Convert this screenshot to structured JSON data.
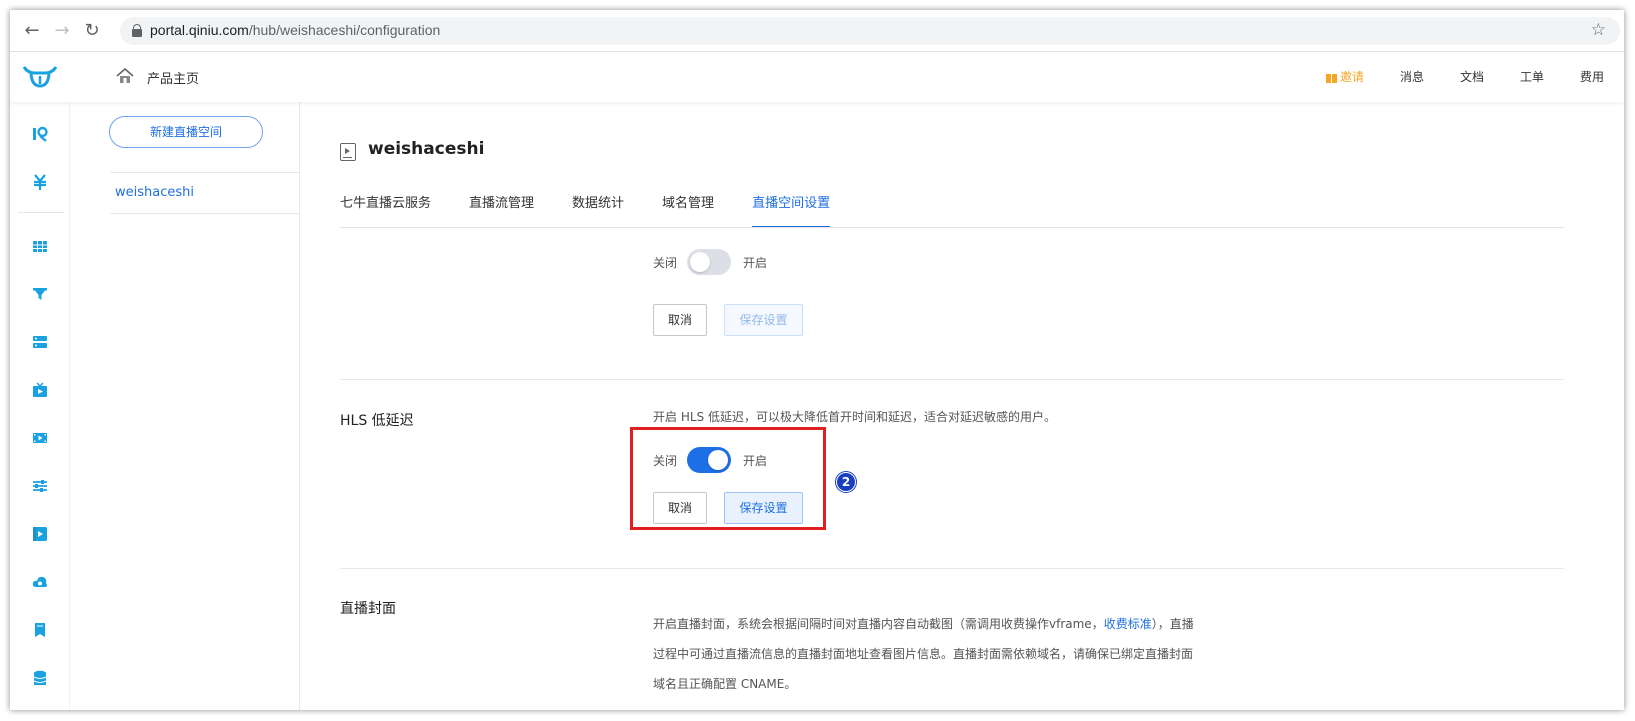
{
  "browser": {
    "url_host": "portal.qiniu.com",
    "url_path": "/hub/weishaceshi/configuration"
  },
  "header": {
    "home_label": "产品主页",
    "nav": [
      {
        "label": "邀请"
      },
      {
        "label": "消息"
      },
      {
        "label": "文档"
      },
      {
        "label": "工单"
      },
      {
        "label": "费用"
      }
    ]
  },
  "sidebar": {
    "new_space_label": "新建直播空间",
    "items": [
      {
        "label": "weishaceshi"
      }
    ]
  },
  "main": {
    "space_title": "weishaceshi",
    "tabs": [
      {
        "label": "七牛直播云服务"
      },
      {
        "label": "直播流管理"
      },
      {
        "label": "数据统计"
      },
      {
        "label": "域名管理"
      },
      {
        "label": "直播空间设置"
      }
    ],
    "sections": {
      "top": {
        "switch_off_label": "关闭",
        "switch_on_label": "开启",
        "cancel_label": "取消",
        "save_label": "保存设置",
        "enabled": false
      },
      "hls": {
        "title": "HLS 低延迟",
        "desc": "开启 HLS 低延迟，可以极大降低首开时间和延迟，适合对延迟敏感的用户。",
        "switch_off_label": "关闭",
        "switch_on_label": "开启",
        "cancel_label": "取消",
        "save_label": "保存设置",
        "enabled": true
      },
      "cover": {
        "title": "直播封面",
        "desc_1a": "开启直播封面，系统会根据间隔时间对直播内容自动截图（需调用收费操作vframe，",
        "desc_1_link": "收费标准",
        "desc_1b": "），直播",
        "desc_2": "过程中可通过直播流信息的直播封面地址查看图片信息。直播封面需依赖域名，请确保已绑定直播封面",
        "desc_3": "域名且正确配置 CNAME。"
      }
    }
  },
  "annotation": {
    "step": "2"
  },
  "colors": {
    "accent": "#1e6fe5",
    "highlight": "#e02020",
    "invite": "#f5a623"
  }
}
